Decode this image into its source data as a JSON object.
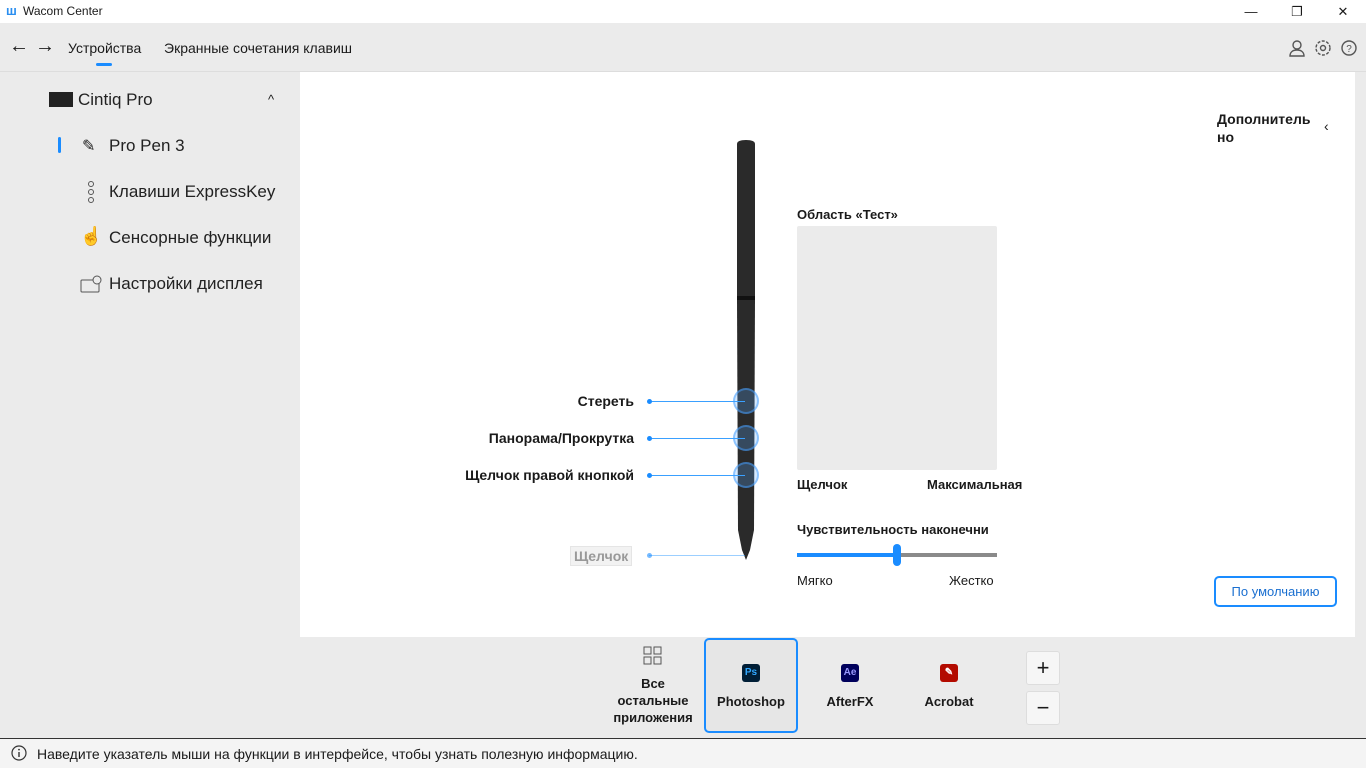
{
  "window": {
    "logo": "ш",
    "title": "Wacom Center",
    "min": "—",
    "max": "❐",
    "close": "✕"
  },
  "nav": {
    "back": "←",
    "forward": "→",
    "tabs": [
      {
        "label": "Устройства",
        "active": true
      },
      {
        "label": "Экранные сочетания клавиш",
        "active": false
      }
    ],
    "icons": [
      "user-icon",
      "gear-icon",
      "help-icon"
    ]
  },
  "sidebar": {
    "device": "Cintiq Pro",
    "collapse": "^",
    "items": [
      {
        "label": "Pro Pen 3",
        "icon": "pen-icon",
        "active": true
      },
      {
        "label": "Клавиши ExpressKey",
        "icon": "expresskey-icon"
      },
      {
        "label": "Сенсорные функции",
        "icon": "touch-hand-icon"
      },
      {
        "label": "Настройки дисплея",
        "icon": "display-settings-icon"
      }
    ]
  },
  "main": {
    "more": "Дополнитель но",
    "pen_buttons": [
      "Стереть",
      "Панорама/Прокрутка",
      "Щелчок правой кнопкой"
    ],
    "tip": "Щелчок",
    "test": {
      "title": "Область «Тест»",
      "left": "Щелчок",
      "right": "Максимальная"
    },
    "sensitivity": {
      "title": "Чувствительность наконечни",
      "min": "Мягко",
      "max": "Жестко",
      "value": 0.5
    },
    "default_button": "По умолчанию"
  },
  "apps": {
    "items": [
      {
        "label": "Все остальные приложения",
        "icon": "grid-icon"
      },
      {
        "label": "Photoshop",
        "badge": "Ps",
        "color": "#001e36",
        "fg": "#31a8ff",
        "selected": true
      },
      {
        "label": "AfterFX",
        "badge": "Ae",
        "color": "#00005b",
        "fg": "#9999ff"
      },
      {
        "label": "Acrobat",
        "badge": "✎",
        "color": "#b30b00",
        "fg": "#fff"
      }
    ],
    "add": "+",
    "remove": "−"
  },
  "status": {
    "icon": "info-icon",
    "text": "Наведите указатель мыши на функции в интерфейсе, чтобы узнать полезную информацию."
  },
  "colors": {
    "accent": "#1a8cff"
  }
}
